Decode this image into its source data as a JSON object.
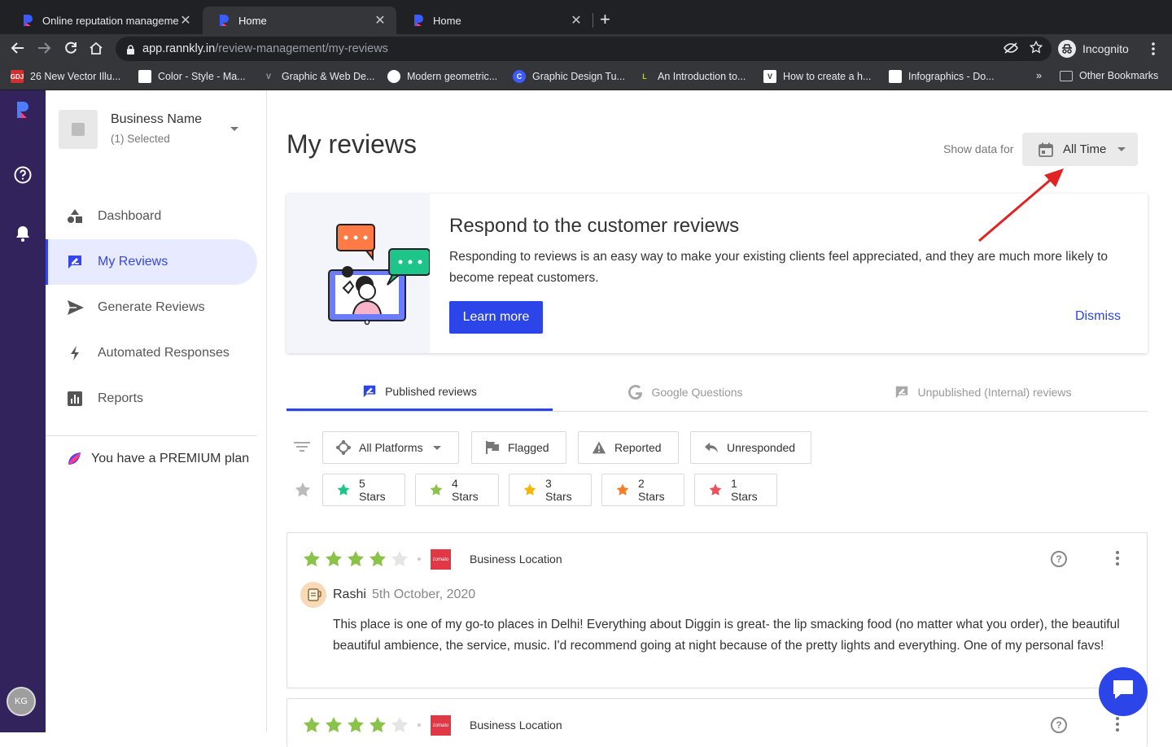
{
  "browser": {
    "tabs": [
      {
        "title": "Online reputation managemen"
      },
      {
        "title": "Home"
      },
      {
        "title": "Home"
      }
    ],
    "url_host": "app.rannkly.in",
    "url_path": "/review-management/my-reviews",
    "incognito_label": "Incognito",
    "bookmarks": [
      {
        "label": "26 New Vector Illu...",
        "icon": "GDJ"
      },
      {
        "label": "Color - Style - Ma...",
        "icon": ""
      },
      {
        "label": "Graphic & Web De...",
        "icon": "V"
      },
      {
        "label": "Modern geometric...",
        "icon": ""
      },
      {
        "label": "Graphic Design Tu...",
        "icon": "C"
      },
      {
        "label": "An Introduction to...",
        "icon": "L"
      },
      {
        "label": "How to create a h...",
        "icon": "V"
      },
      {
        "label": "Infographics - Do...",
        "icon": ""
      }
    ],
    "bookmarks_more": "»",
    "other_bookmarks": "Other Bookmarks"
  },
  "rail": {
    "avatar_initials": "KG"
  },
  "sidebar": {
    "business_name": "Business Name",
    "business_selected": "(1) Selected",
    "nav": [
      {
        "label": "Dashboard",
        "icon": "shapes-icon"
      },
      {
        "label": "My Reviews",
        "icon": "review-icon"
      },
      {
        "label": "Generate Reviews",
        "icon": "send-icon"
      },
      {
        "label": "Automated Responses",
        "icon": "bolt-icon"
      },
      {
        "label": "Reports",
        "icon": "bar-chart-icon"
      }
    ],
    "plan_prefix": "You have a ",
    "plan_name": "PREMIUM",
    "plan_suffix": " plan"
  },
  "header": {
    "title": "My reviews",
    "show_data_label": "Show data for",
    "time_filter": "All Time"
  },
  "banner": {
    "heading": "Respond to the customer reviews",
    "body": "Responding to reviews is an easy way to make your existing clients feel appreciated, and they are much more likely to become repeat customers.",
    "cta": "Learn more",
    "dismiss": "Dismiss"
  },
  "review_tabs": [
    {
      "label": "Published reviews",
      "active": true
    },
    {
      "label": "Google Questions",
      "active": false
    },
    {
      "label": "Unpublished (Internal) reviews",
      "active": false
    }
  ],
  "filters": {
    "platforms": "All Platforms",
    "flagged": "Flagged",
    "reported": "Reported",
    "unresponded": "Unresponded",
    "stars": [
      {
        "label": "5 Stars",
        "color": "#1ec58b"
      },
      {
        "label": "4 Stars",
        "color": "#8bc34a"
      },
      {
        "label": "3 Stars",
        "color": "#f5b500"
      },
      {
        "label": "2 Stars",
        "color": "#f57c28"
      },
      {
        "label": "1 Stars",
        "color": "#ef4f5a"
      }
    ]
  },
  "reviews": [
    {
      "rating": 4,
      "platform_badge": "zomato",
      "location": "Business Location",
      "author": "Rashi",
      "date": "5th October, 2020",
      "text": "This place is one of my go-to places in Delhi! Everything about Diggin is great- the lip smacking food (no matter what you order), the beautiful beautiful ambience, the service, music. I'd recommend going at night because of the pretty lights and everything. One of my personal favs!"
    },
    {
      "rating": 4,
      "platform_badge": "zomato",
      "location": "Business Location"
    }
  ],
  "colors": {
    "accent": "#2b45e8",
    "rail": "#33235c",
    "star_filled": "#8bc34a",
    "star_empty": "#e5e5e5",
    "annotation_arrow": "#e02424"
  }
}
